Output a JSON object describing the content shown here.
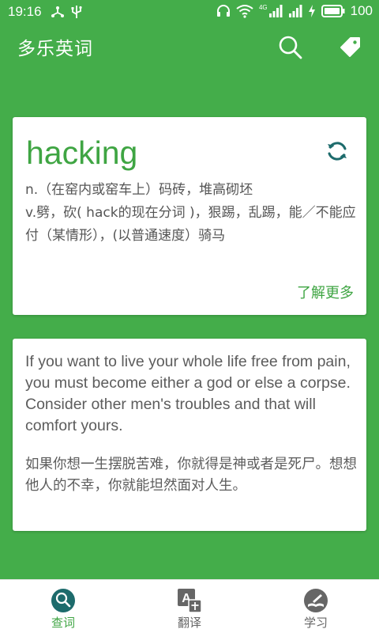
{
  "status_bar": {
    "time": "19:16",
    "battery": "100",
    "network": "4G",
    "icons": [
      "usb-share-icon",
      "usb-icon",
      "headphone-icon",
      "wifi-icon",
      "signal-icon",
      "signal-icon",
      "charging-icon",
      "battery-icon"
    ]
  },
  "app_bar": {
    "title": "多乐英词",
    "icons": [
      "search-icon",
      "tag-icon"
    ]
  },
  "word_card": {
    "word": "hacking",
    "definitions": [
      "n.（在窑内或窑车上）码砖，堆高砌坯",
      "v.劈，砍( hack的现在分词 )，狠踢，乱踢，能／不能应付（某情形），(以普通速度）骑马"
    ],
    "more_label": "了解更多",
    "refresh_icon": "refresh-icon"
  },
  "quote_card": {
    "english": "If you want to live your whole life free from pain, you must become either a god or else a corpse. Consider other men's troubles and that will comfort yours.",
    "chinese": "如果你想一生摆脱苦难，你就得是神或者是死尸。想想他人的不幸，你就能坦然面对人生。"
  },
  "bottom_nav": {
    "items": [
      {
        "label": "查词",
        "icon": "lookup-icon",
        "active": true
      },
      {
        "label": "翻译",
        "icon": "translate-icon",
        "active": false
      },
      {
        "label": "学习",
        "icon": "study-icon",
        "active": false
      }
    ]
  },
  "colors": {
    "primary": "#44ad4a",
    "accent_text": "#3fa543",
    "active_nav": "#1d6b6c",
    "inactive_nav": "#666666"
  }
}
